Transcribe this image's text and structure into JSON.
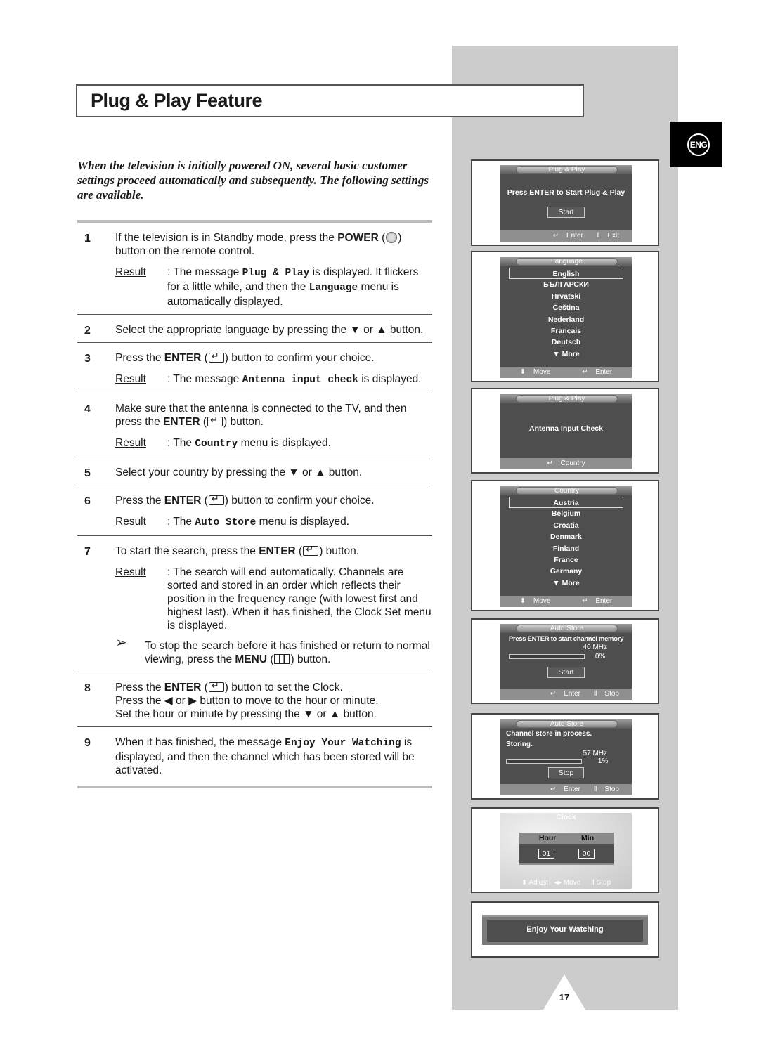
{
  "page": {
    "title": "Plug & Play Feature",
    "language_badge": "ENG",
    "intro": "When the television is initially powered ON, several basic customer settings proceed automatically and subsequently. The following settings are available.",
    "page_number": "17"
  },
  "steps": [
    {
      "num": "1",
      "pre": "If the television is in Standby mode, press the ",
      "key": "POWER",
      "icon": "power-icon",
      "post": " button on the remote control.",
      "result_label": "Result",
      "result_pre": "The message ",
      "result_code": "Plug & Play",
      "result_post": " is displayed. It flickers for a little while, and then the ",
      "result_code2": "Language",
      "result_post2": " menu is automatically displayed."
    },
    {
      "num": "2",
      "text": "Select the appropriate language by pressing the ▼ or ▲ button."
    },
    {
      "num": "3",
      "pre": "Press the ",
      "key": "ENTER",
      "icon": "enter-icon",
      "post": " button to confirm your choice.",
      "result_label": "Result",
      "result_pre": "The message ",
      "result_code": "Antenna input check",
      "result_post": " is displayed."
    },
    {
      "num": "4",
      "pre": "Make sure that the antenna is connected to the TV, and then press the ",
      "key": "ENTER",
      "icon": "enter-icon",
      "post": " button.",
      "result_label": "Result",
      "result_pre": "The ",
      "result_code": "Country",
      "result_post": " menu is displayed."
    },
    {
      "num": "5",
      "text": "Select your country by pressing the ▼ or ▲ button."
    },
    {
      "num": "6",
      "pre": "Press the ",
      "key": "ENTER",
      "icon": "enter-icon",
      "post": " button to confirm your choice.",
      "result_label": "Result",
      "result_pre": "The ",
      "result_code": "Auto Store",
      "result_post": " menu is displayed."
    },
    {
      "num": "7",
      "pre": "To start the search, press the ",
      "key": "ENTER",
      "icon": "enter-icon",
      "post": " button.",
      "result_label": "Result",
      "result_text": "The search will end automatically. Channels are sorted and stored in an order which reflects their position in the frequency range (with lowest first and highest last). When it has finished, the Clock Set menu is displayed.",
      "note_arrow": "➢",
      "note_pre": "To stop the search before it has finished or return to normal viewing, press the ",
      "note_key": "MENU",
      "note_post": " button."
    },
    {
      "num": "8",
      "pre": "Press the ",
      "key": "ENTER",
      "icon": "enter-icon",
      "post": " button to set the Clock.",
      "line2": "Press the ◀ or ▶ button to move to the hour or minute.",
      "line3": "Set the hour or minute by pressing the ▼ or ▲ button."
    },
    {
      "num": "9",
      "pre": "When it has finished, the message ",
      "code": "Enjoy Your Watching",
      "post": " is displayed, and then the channel which has been stored will be activated."
    }
  ],
  "screens": {
    "plug_play": {
      "title": "Plug & Play",
      "message": "Press ENTER to Start Plug & Play",
      "button": "Start",
      "footer": [
        "Enter",
        "Exit"
      ]
    },
    "language": {
      "title": "Language",
      "items": [
        "English",
        "БЪЛГАРСКИ",
        "Hrvatski",
        "Čeština",
        "Nederland",
        "Français",
        "Deutsch"
      ],
      "selected": "English",
      "more": "▼ More",
      "footer": [
        "Move",
        "Enter"
      ]
    },
    "antenna": {
      "title": "Plug & Play",
      "message": "Antenna Input Check",
      "footer": [
        "Country"
      ]
    },
    "country": {
      "title": "Country",
      "items": [
        "Austria",
        "Belgium",
        "Croatia",
        "Denmark",
        "Finland",
        "France",
        "Germany"
      ],
      "selected": "Austria",
      "more": "▼ More",
      "footer": [
        "Move",
        "Enter"
      ]
    },
    "auto_store_start": {
      "title": "Auto Store",
      "message": "Press ENTER to start channel memory",
      "frequency": "40 MHz",
      "progress_label": "0%",
      "progress": 0,
      "button": "Start",
      "footer": [
        "Enter",
        "Stop"
      ]
    },
    "auto_store_running": {
      "title": "Auto Store",
      "line1": "Channel store in process.",
      "line2": "Storing.",
      "frequency": "57 MHz",
      "progress_label": "1%",
      "progress": 1,
      "button": "Stop",
      "footer": [
        "Enter",
        "Stop"
      ]
    },
    "clock": {
      "title": "Clock",
      "hour_label": "Hour",
      "min_label": "Min",
      "hour": "01",
      "min": "00",
      "footer": [
        "Adjust",
        "Move",
        "Stop"
      ]
    },
    "enjoy": {
      "message": "Enjoy Your Watching"
    }
  }
}
